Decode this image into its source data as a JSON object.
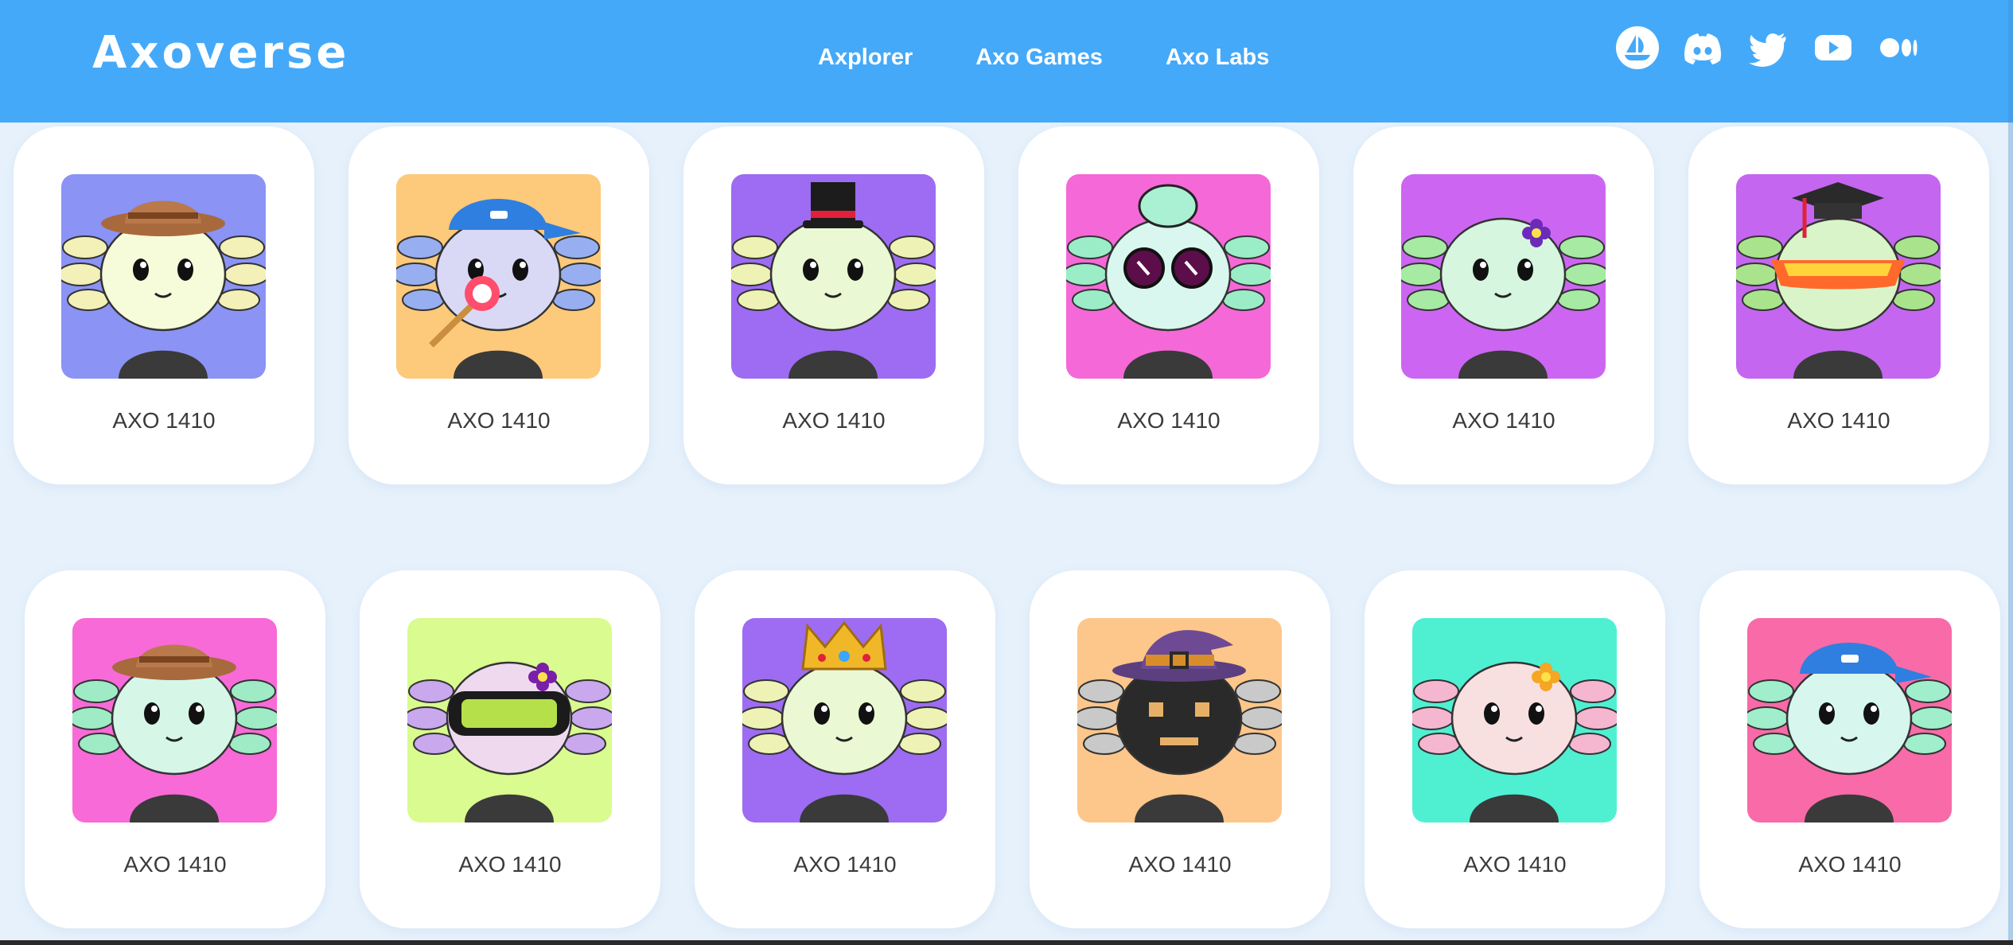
{
  "header": {
    "logo": "Axoverse",
    "nav": [
      {
        "label": "Axplorer"
      },
      {
        "label": "Axo Games"
      },
      {
        "label": "Axo Labs"
      }
    ],
    "socials": [
      "opensea-icon",
      "discord-icon",
      "twitter-icon",
      "youtube-icon",
      "medium-icon"
    ]
  },
  "gallery": {
    "cards": [
      {
        "label": "AXO 1410",
        "bg": "#8b93f5",
        "skin": "#f6fbd9",
        "gill": "#f3f0b8",
        "accessory": "cowboy-hat"
      },
      {
        "label": "AXO 1410",
        "bg": "#fdc97a",
        "skin": "#d9d9f6",
        "gill": "#97aff1",
        "accessory": "cap-lollipop"
      },
      {
        "label": "AXO 1410",
        "bg": "#9d6cf2",
        "skin": "#eaf8d3",
        "gill": "#eef2b4",
        "accessory": "top-hat"
      },
      {
        "label": "AXO 1410",
        "bg": "#f568d8",
        "skin": "#d9f7ee",
        "gill": "#9bedc8",
        "accessory": "sunglasses"
      },
      {
        "label": "AXO 1410",
        "bg": "#cc66f2",
        "skin": "#d6f6df",
        "gill": "#a6eaa3",
        "accessory": "flower"
      },
      {
        "label": "AXO 1410",
        "bg": "#c466ef",
        "skin": "#d9f4c9",
        "gill": "#a9e48d",
        "accessory": "grad-cap"
      },
      {
        "label": "AXO 1410",
        "bg": "#f86ad8",
        "skin": "#d6f6e8",
        "gill": "#9eebc5",
        "accessory": "cowboy-hat"
      },
      {
        "label": "AXO 1410",
        "bg": "#d9fb8f",
        "skin": "#eed9ef",
        "gill": "#c9a8ee",
        "accessory": "visor"
      },
      {
        "label": "AXO 1410",
        "bg": "#9d6cf2",
        "skin": "#eaf8d3",
        "gill": "#eef2b4",
        "accessory": "crown"
      },
      {
        "label": "AXO 1410",
        "bg": "#fdc68a",
        "skin": "#2a2a2a",
        "gill": "#c9c9c9",
        "accessory": "witch-hat"
      },
      {
        "label": "AXO 1410",
        "bg": "#4ff0d2",
        "skin": "#f8e0e0",
        "gill": "#f5b6d0",
        "accessory": "flower-orange"
      },
      {
        "label": "AXO 1410",
        "bg": "#f86aa8",
        "skin": "#d6f6ee",
        "gill": "#a0eecb",
        "accessory": "cap"
      }
    ]
  }
}
